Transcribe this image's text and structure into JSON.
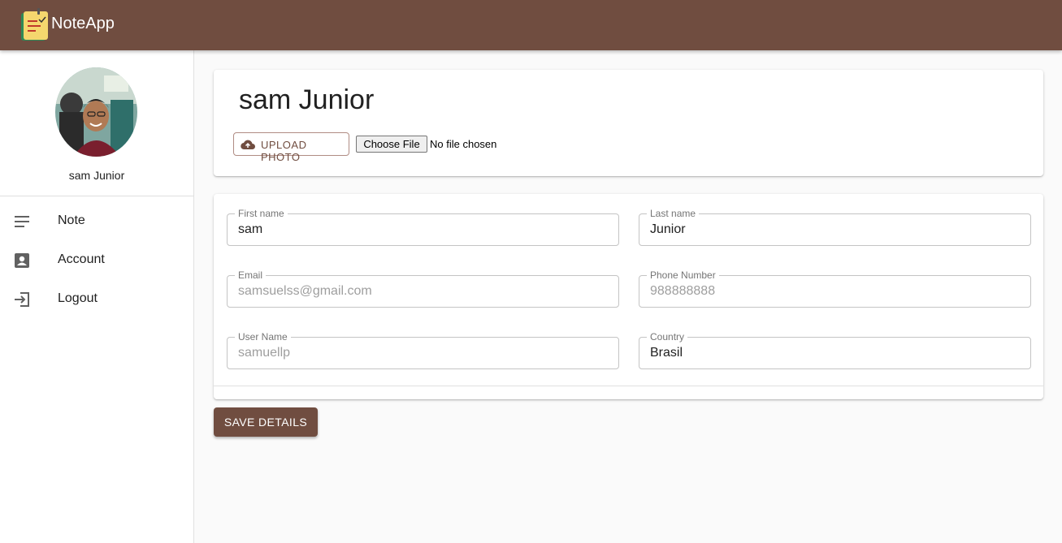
{
  "app": {
    "title": "NoteApp"
  },
  "sidebar": {
    "username": "sam Junior",
    "items": [
      {
        "label": "Note",
        "icon": "notes-icon"
      },
      {
        "label": "Account",
        "icon": "account-box-icon"
      },
      {
        "label": "Logout",
        "icon": "logout-icon"
      }
    ]
  },
  "profile": {
    "name": "sam Junior",
    "upload_label": "UPLOAD PHOTO",
    "file_button_label": "Choose File",
    "file_status": "No file chosen"
  },
  "form": {
    "first_name": {
      "label": "First name",
      "value": "sam"
    },
    "last_name": {
      "label": "Last name",
      "value": "Junior"
    },
    "email": {
      "label": "Email",
      "value": "samsuelss@gmail.com"
    },
    "phone": {
      "label": "Phone Number",
      "value": "988888888"
    },
    "username": {
      "label": "User Name",
      "value": "samuellp"
    },
    "country": {
      "label": "Country",
      "value": "Brasil"
    }
  },
  "actions": {
    "save_label": "SAVE DETAILS"
  },
  "colors": {
    "primary": "#704d40",
    "background": "#fafafa"
  }
}
